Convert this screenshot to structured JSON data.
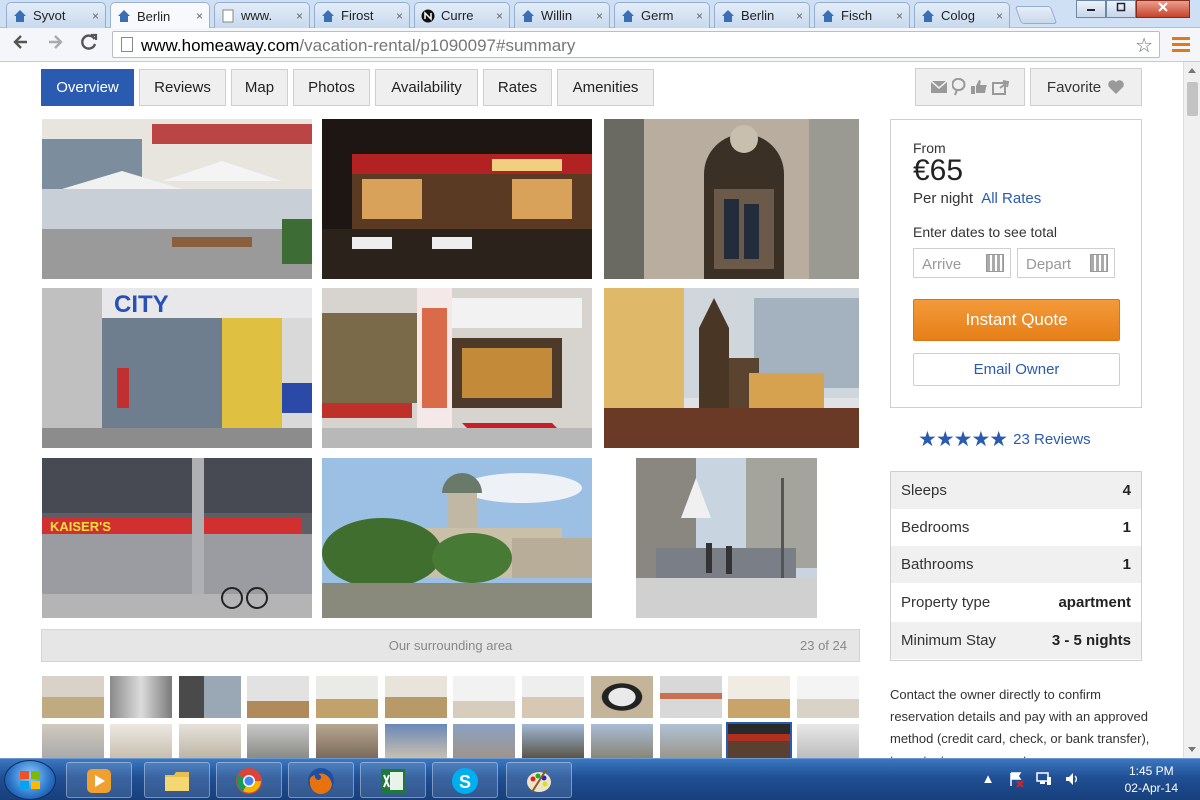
{
  "browser": {
    "tabs": [
      {
        "title": "Syvot",
        "active": false
      },
      {
        "title": "Berlin",
        "active": true
      },
      {
        "title": "www.",
        "active": false
      },
      {
        "title": "Firost",
        "active": false
      },
      {
        "title": "Curre",
        "active": false
      },
      {
        "title": "Willin",
        "active": false
      },
      {
        "title": "Germ",
        "active": false
      },
      {
        "title": "Berlin",
        "active": false
      },
      {
        "title": "Fisch",
        "active": false
      },
      {
        "title": "Colog",
        "active": false
      }
    ],
    "tab_close_glyph": "×",
    "url_host": "www.homeaway.com",
    "url_path": "/vacation-rental/p1090097#summary"
  },
  "nav_tabs": [
    {
      "label": "Overview",
      "active": true
    },
    {
      "label": "Reviews",
      "active": false
    },
    {
      "label": "Map",
      "active": false
    },
    {
      "label": "Photos",
      "active": false
    },
    {
      "label": "Availability",
      "active": false
    },
    {
      "label": "Rates",
      "active": false
    },
    {
      "label": "Amenities",
      "active": false
    }
  ],
  "favorite_label": "Favorite",
  "gallery": {
    "caption": "Our surrounding area",
    "counter": "23 of 24",
    "main_photos": [
      {
        "name": "photo-restaurant-street",
        "tone": "#9aa7b8"
      },
      {
        "name": "photo-night-terrace",
        "tone": "#3a2a22"
      },
      {
        "name": "photo-entrance-door",
        "tone": "#8a7c6a"
      },
      {
        "name": "photo-city-store",
        "tone": "#7e8ea4"
      },
      {
        "name": "photo-currywurst-museum",
        "tone": "#8c7560"
      },
      {
        "name": "photo-church-model",
        "tone": "#5a4530"
      },
      {
        "name": "photo-kaisers-supermarket",
        "tone": "#4a4a52"
      },
      {
        "name": "photo-dome-square",
        "tone": "#7d9a7a"
      },
      {
        "name": "photo-street-scene",
        "tone": "#8b8f96"
      }
    ],
    "selected_thumb_index": 23
  },
  "booking": {
    "from_label": "From",
    "price": "€65",
    "per_night": "Per night",
    "all_rates": "All Rates",
    "enter_dates": "Enter dates to see total",
    "arrive_placeholder": "Arrive",
    "depart_placeholder": "Depart",
    "instant_quote": "Instant Quote",
    "email_owner": "Email Owner"
  },
  "rating": {
    "stars": 5,
    "stars_text": "★★★★★",
    "reviews": "23 Reviews"
  },
  "facts": [
    {
      "key": "Sleeps",
      "value": "4"
    },
    {
      "key": "Bedrooms",
      "value": "1"
    },
    {
      "key": "Bathrooms",
      "value": "1"
    },
    {
      "key": "Property type",
      "value": "apartment"
    },
    {
      "key": "Minimum Stay",
      "value": "3 - 5 nights"
    }
  ],
  "contact_text": "Contact the owner directly to confirm reservation details and pay with an approved method (credit card, check, or bank transfer), to protect your payment.",
  "taskbar": {
    "time": "1:45 PM",
    "date": "02-Apr-14",
    "apps": [
      "media-player",
      "file-explorer",
      "chrome",
      "firefox",
      "excel",
      "skype",
      "paint"
    ]
  },
  "colors": {
    "accent_blue": "#2a5bb0",
    "quote_orange": "#e67f18",
    "taskbar_blue": "#1f4f94"
  }
}
